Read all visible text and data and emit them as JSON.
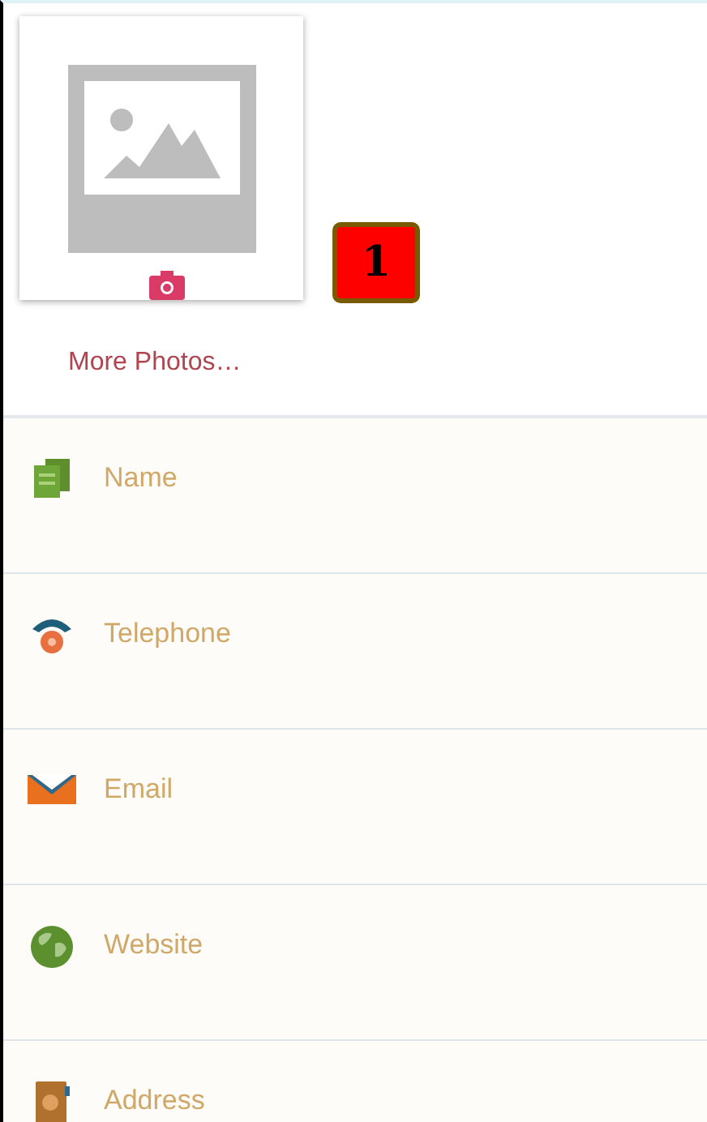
{
  "photo": {
    "link": "More Photos…"
  },
  "marker": "1",
  "fields": [
    {
      "kind": "name",
      "placeholder": "Name"
    },
    {
      "kind": "telephone",
      "placeholder": "Telephone"
    },
    {
      "kind": "email",
      "placeholder": "Email"
    },
    {
      "kind": "website",
      "placeholder": "Website"
    },
    {
      "kind": "address",
      "placeholder": "Address"
    }
  ]
}
